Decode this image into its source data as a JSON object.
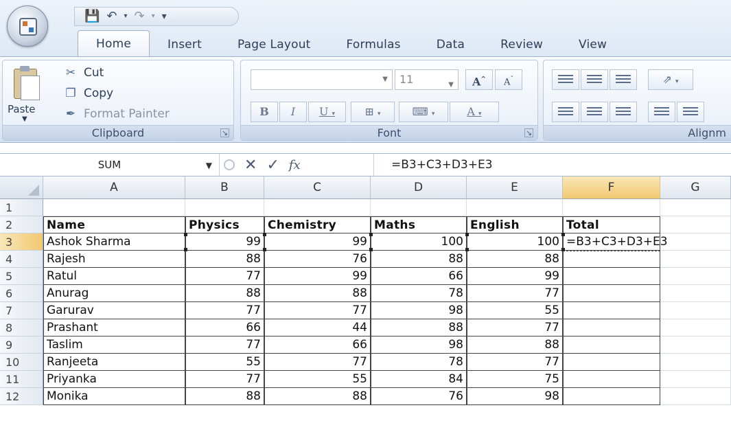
{
  "ribbon": {
    "tabs": [
      "Home",
      "Insert",
      "Page Layout",
      "Formulas",
      "Data",
      "Review",
      "View"
    ],
    "clipboard": {
      "paste_label": "Paste",
      "cut_label": "Cut",
      "copy_label": "Copy",
      "format_painter_label": "Format Painter",
      "group_label": "Clipboard"
    },
    "font": {
      "font_name": "",
      "font_size": "11",
      "group_label": "Font"
    },
    "alignment": {
      "group_label": "Alignm"
    }
  },
  "formula_bar": {
    "name_box": "SUM",
    "formula": "=B3+C3+D3+E3"
  },
  "sheet": {
    "columns": [
      "A",
      "B",
      "C",
      "D",
      "E",
      "F",
      "G"
    ],
    "rows": [
      "1",
      "2",
      "3",
      "4",
      "5",
      "6",
      "7",
      "8",
      "9",
      "10",
      "11",
      "12"
    ],
    "headers": [
      "Name",
      "Physics",
      "Chemistry",
      "Maths",
      "English",
      "Total"
    ],
    "records": [
      [
        "Ashok Sharma",
        "99",
        "99",
        "100",
        "100",
        "=B3+C3+D3+E3"
      ],
      [
        "Rajesh",
        "88",
        "76",
        "88",
        "88",
        ""
      ],
      [
        "Ratul",
        "77",
        "99",
        "66",
        "99",
        ""
      ],
      [
        "Anurag",
        "88",
        "88",
        "78",
        "77",
        ""
      ],
      [
        "Garurav",
        "77",
        "77",
        "98",
        "55",
        ""
      ],
      [
        "Prashant",
        "66",
        "44",
        "88",
        "77",
        ""
      ],
      [
        "Taslim",
        "77",
        "66",
        "98",
        "88",
        ""
      ],
      [
        "Ranjeeta",
        "55",
        "77",
        "78",
        "77",
        ""
      ],
      [
        "Priyanka",
        "77",
        "55",
        "84",
        "75",
        ""
      ],
      [
        "Monika",
        "88",
        "88",
        "76",
        "98",
        ""
      ]
    ]
  },
  "colors": {
    "active_header": "#f1c86f",
    "ribbon_bg": "#e4ecf7",
    "grid_line": "#d8dee8"
  }
}
